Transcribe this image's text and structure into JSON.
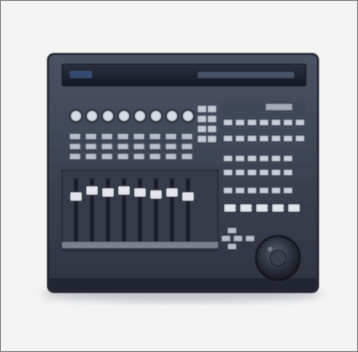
{
  "image": {
    "subject": "mixing-control-surface",
    "faders": 8,
    "colors": {
      "background": "#f3f3f3",
      "border": "#8a8a8a",
      "body": "#3b4150",
      "body_dark": "#222733",
      "display": "#1b1f2b",
      "panel": "#4a5162",
      "key": "#c9ced8",
      "knob": "#2a2f3b"
    }
  }
}
